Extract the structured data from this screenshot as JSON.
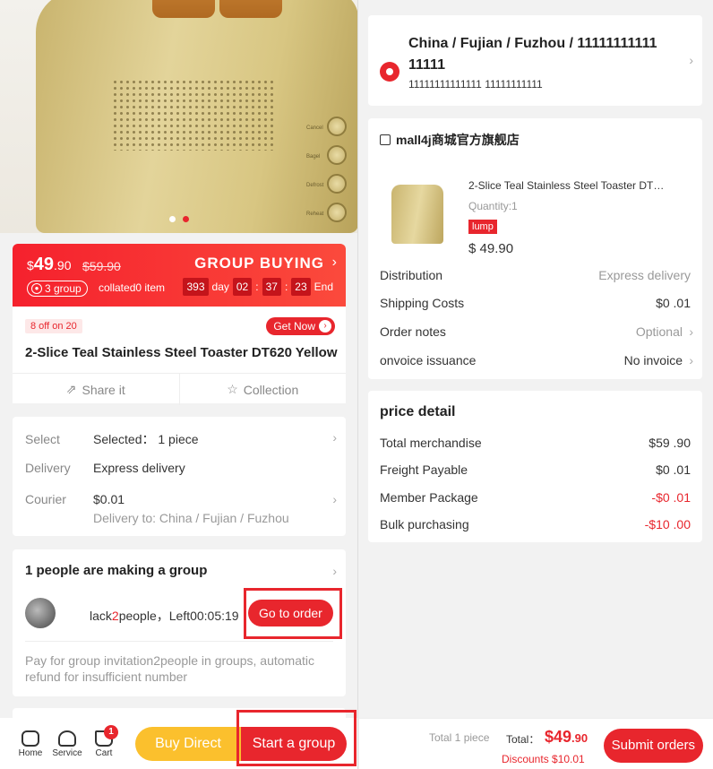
{
  "colors": {
    "accent": "#e8262d",
    "yellow": "#fbc02d"
  },
  "hero": {
    "image": "yellow-toaster-with-toast",
    "knobs": [
      "Cancel",
      "Bagel",
      "Defrost",
      "Reheat"
    ],
    "slides": 2,
    "active_slide": 2
  },
  "group_bar": {
    "currency": "$",
    "price_int": "49",
    "price_dec": ".90",
    "price_old": "$59.90",
    "title": "GROUP BUYING",
    "group_badge": "3 group",
    "collated": "collated0 item",
    "cd_days": "393",
    "day_label": "day",
    "cd_h": "02",
    "cd_m": "37",
    "cd_s": "23",
    "end_label": "End"
  },
  "product": {
    "off_tag": "8 off on 20",
    "get_now": "Get Now",
    "title": "2-Slice Teal Stainless Steel Toaster DT620 Yellow",
    "share": "Share it",
    "collection": "Collection"
  },
  "select_card": {
    "select_k": "Select",
    "select_v": "Selected： 1  piece",
    "delivery_k": "Delivery",
    "delivery_v": "Express delivery",
    "courier_k": "Courier",
    "courier_v": "$0.01",
    "delivery_to": "Delivery to: China / Fujian / Fuzhou"
  },
  "group_card": {
    "title": "1 people are making a group",
    "lack_pre": "lack",
    "lack_num": "2",
    "lack_post": "people，Left00:05:19",
    "go_order": "Go to order",
    "note": "Pay for group invitation2people in groups, automatic refund for insufficient number"
  },
  "bottom_left": {
    "home": "Home",
    "service": "Service",
    "cart": "Cart",
    "cart_count": "1",
    "buy_direct": "Buy Direct",
    "start_group": "Start a group"
  },
  "address": {
    "line1": "China / Fujian / Fuzhou / 11111111111 11111",
    "line2": "11111111111111 11111111111"
  },
  "order": {
    "shop": "mall4j商城官方旗舰店",
    "item_title": "2-Slice Teal Stainless Steel Toaster DT…",
    "quantity": "Quantity:1",
    "lump": "lump",
    "item_price": "$ 49.90",
    "rows": [
      {
        "k": "Distribution",
        "v": "Express delivery"
      },
      {
        "k": "Shipping Costs",
        "v": "$0 .01"
      },
      {
        "k": "Order notes",
        "v": "Optional"
      },
      {
        "k": "onvoice issuance",
        "v": "No invoice"
      }
    ]
  },
  "price_detail": {
    "title": "price detail",
    "rows": [
      {
        "k": "Total merchandise",
        "v": "$59 .90"
      },
      {
        "k": "Freight Payable",
        "v": "$0 .01"
      },
      {
        "k": "Member Package",
        "v": "-$0 .01"
      },
      {
        "k": "Bulk purchasing",
        "v": "-$10 .00"
      }
    ]
  },
  "bottom_right": {
    "total_pieces": "Total  1  piece",
    "total_label": "Total：",
    "total_int": "$49",
    "total_dec": ".90",
    "discounts": "Discounts $10.01",
    "submit": "Submit orders"
  }
}
